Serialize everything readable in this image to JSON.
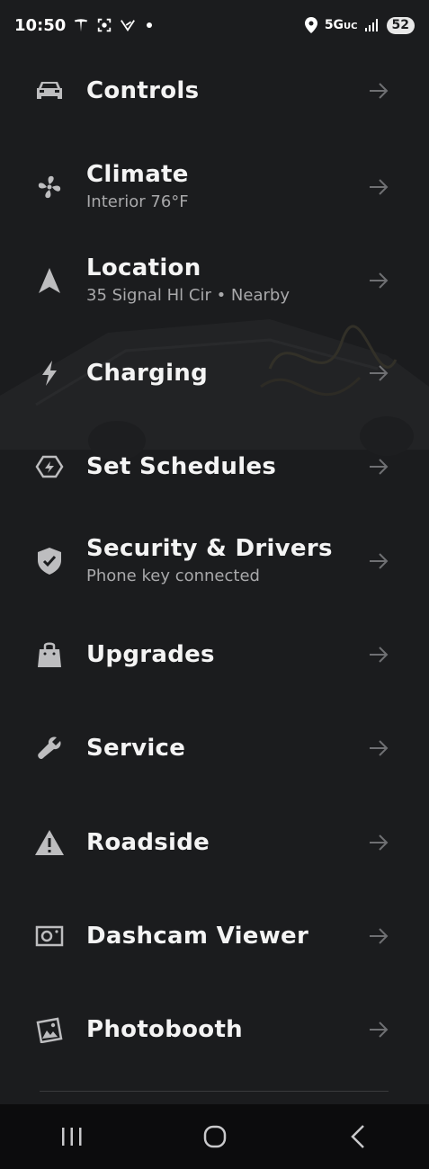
{
  "status_bar": {
    "time": "10:50",
    "network": "5G",
    "network_suffix": "UC",
    "battery": "52"
  },
  "menu": [
    {
      "title": "Controls",
      "subtitle": "",
      "icon": "car-icon"
    },
    {
      "title": "Climate",
      "subtitle": "Interior 76°F",
      "icon": "fan-icon"
    },
    {
      "title": "Location",
      "subtitle": "35 Signal Hl Cir • Nearby",
      "icon": "location-arrow-icon"
    },
    {
      "title": "Charging",
      "subtitle": "",
      "icon": "lightning-icon"
    },
    {
      "title": "Set Schedules",
      "subtitle": "",
      "icon": "schedule-icon"
    },
    {
      "title": "Security & Drivers",
      "subtitle": "Phone key connected",
      "icon": "shield-check-icon"
    },
    {
      "title": "Upgrades",
      "subtitle": "",
      "icon": "shopping-bag-icon"
    },
    {
      "title": "Service",
      "subtitle": "",
      "icon": "wrench-icon"
    },
    {
      "title": "Roadside",
      "subtitle": "",
      "icon": "warning-icon"
    },
    {
      "title": "Dashcam Viewer",
      "subtitle": "",
      "icon": "dashcam-icon"
    },
    {
      "title": "Photobooth",
      "subtitle": "",
      "icon": "photo-icon"
    }
  ],
  "nav_bar": {
    "recents": "recents-icon",
    "home": "home-icon",
    "back": "back-icon"
  }
}
